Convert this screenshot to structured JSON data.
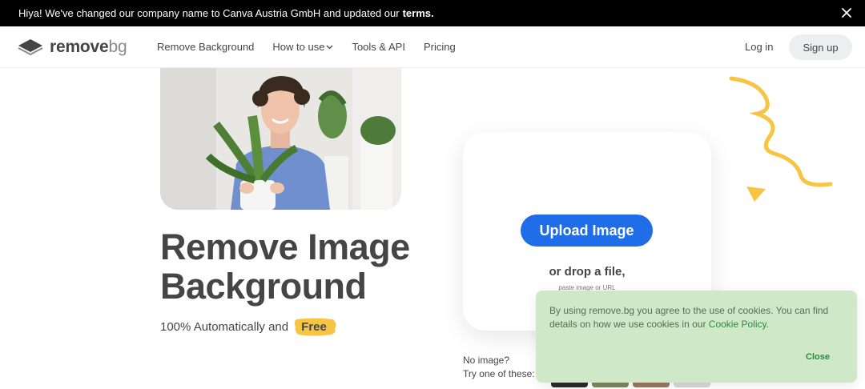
{
  "announcement": {
    "text": "Hiya! We've changed our company name to Canva Austria GmbH and updated our",
    "link": "terms."
  },
  "nav": {
    "logo_main": "remove",
    "logo_suffix": "bg",
    "links": [
      "Remove Background",
      "How to use",
      "Tools & API",
      "Pricing"
    ],
    "login": "Log in",
    "signup": "Sign up"
  },
  "hero": {
    "title_line1": "Remove Image",
    "title_line2": "Background",
    "subtitle": "100% Automatically and",
    "badge": "Free"
  },
  "upload": {
    "button": "Upload Image",
    "drop": "or drop a file,",
    "paste": "paste image or URL"
  },
  "samples": {
    "line1": "No image?",
    "line2": "Try one of these:"
  },
  "cookie": {
    "text": "By using remove.bg you agree to the use of cookies. You can find details on how we use cookies in our",
    "link": "Cookie Policy",
    "end": ".",
    "close": "Close"
  },
  "colors": {
    "brand_blue": "#1f6ee8",
    "accent_yellow": "#f7c443",
    "cookie_bg": "#cfe8c8",
    "cookie_link": "#2b8a3e"
  }
}
